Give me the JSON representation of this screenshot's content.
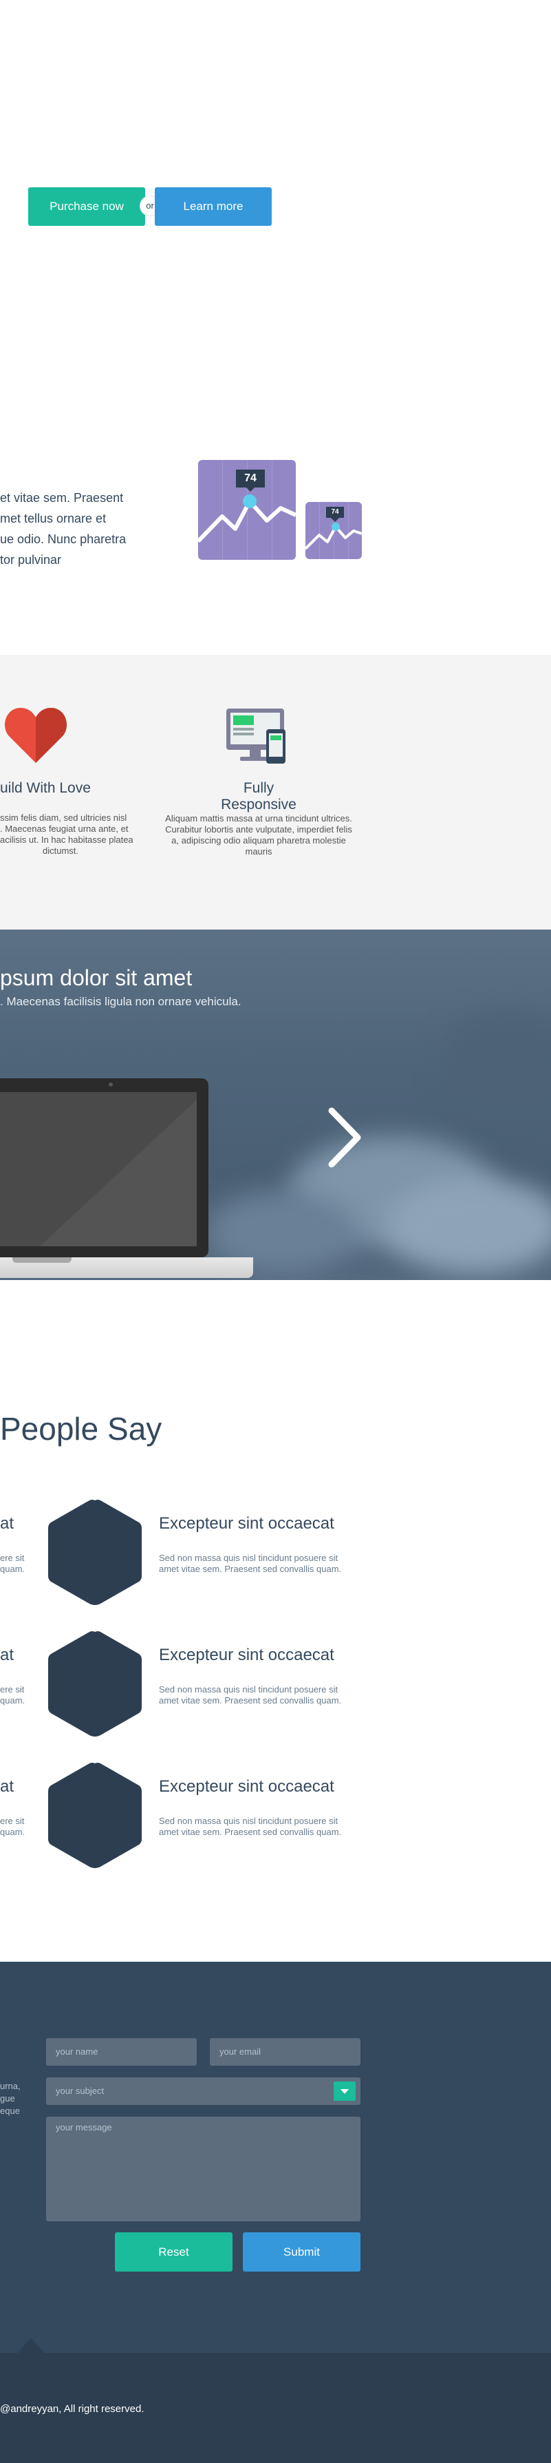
{
  "hero": {
    "purchase_label": "Purchase now",
    "or_label": "or",
    "learn_label": "Learn more"
  },
  "intro": {
    "lines": [
      "et vitae sem. Praesent",
      "met tellus ornare et",
      "ue odio. Nunc pharetra",
      "tor pulvinar"
    ],
    "stat_large": "74",
    "stat_small": "74"
  },
  "features": [
    {
      "title": "uild With Love",
      "icon": "heart-icon",
      "lines": [
        "ssim felis diam, sed ultricies nisl",
        ". Maecenas feugiat urna ante, et",
        "acilisis ut. In hac habitasse platea",
        "dictumst."
      ]
    },
    {
      "title": "Fully Responsive",
      "icon": "devices-icon",
      "lines": [
        "Aliquam mattis massa at urna tincidunt ultrices.",
        "Curabitur lobortis ante vulputate, imperdiet felis",
        "a, adipiscing odio aliquam pharetra molestie",
        "mauris"
      ]
    }
  ],
  "banner": {
    "title": "psum dolor sit amet",
    "subtitle": ". Maecenas facilisis ligula non ornare vehicula.",
    "next_icon": "chevron-right-icon"
  },
  "testimonials": {
    "title": "People Say",
    "items": [
      {
        "left_name": "at",
        "left_lines": [
          "ere sit",
          "quam."
        ],
        "name": "Excepteur sint occaecat",
        "lines": [
          "Sed non massa quis nisl tincidunt posuere sit",
          "amet vitae sem. Praesent sed convallis quam."
        ]
      },
      {
        "left_name": "at",
        "left_lines": [
          "ere sit",
          "quam."
        ],
        "name": "Excepteur sint occaecat",
        "lines": [
          "Sed non massa quis nisl tincidunt posuere sit",
          "amet vitae sem. Praesent sed convallis quam."
        ]
      },
      {
        "left_name": "at",
        "left_lines": [
          "ere sit",
          "quam."
        ],
        "name": "Excepteur sint occaecat",
        "lines": [
          "Sed non massa quis nisl tincidunt posuere sit",
          "amet vitae sem. Praesent sed convallis quam."
        ]
      }
    ]
  },
  "contact": {
    "side_lines": [
      "urna,",
      "gue",
      "eque"
    ],
    "name_placeholder": "your name",
    "email_placeholder": "your email",
    "subject_placeholder": "your subject",
    "message_placeholder": "your message",
    "reset_label": "Reset",
    "submit_label": "Submit"
  },
  "footer": {
    "copyright": "@andreyyan, All right reserved."
  },
  "colors": {
    "teal": "#1abc9c",
    "blue": "#3498db",
    "dark": "#34495e",
    "footer": "#2c3e50"
  }
}
